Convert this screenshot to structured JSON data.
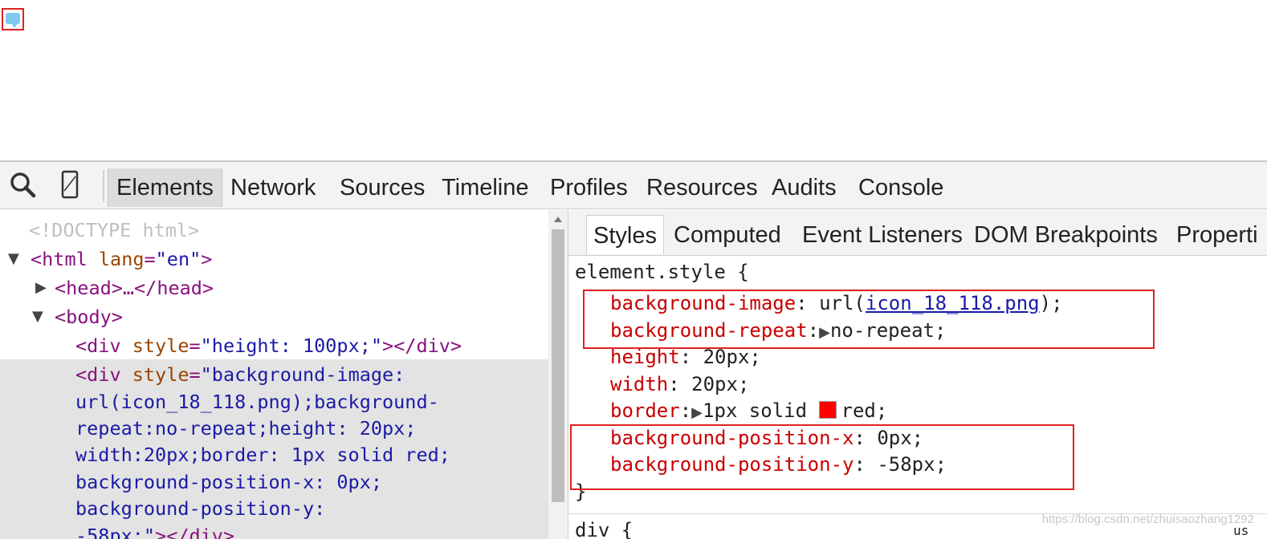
{
  "devtools": {
    "tabs": [
      "Elements",
      "Network",
      "Sources",
      "Timeline",
      "Profiles",
      "Resources",
      "Audits",
      "Console"
    ],
    "active_tab": "Elements",
    "icons": [
      "search-icon",
      "device-mode-icon"
    ]
  },
  "dom_tree": {
    "doctype": "<!DOCTYPE html>",
    "html_open": "<html",
    "html_attr": "lang",
    "html_attr_val": "\"en\"",
    "head_collapsed": "<head>…</head>",
    "body_open": "<body>",
    "div1_open": "<div",
    "div1_attr": "style",
    "div1_val": "\"height: 100px;\"",
    "div1_close": "></div>",
    "div2_open": "<div",
    "div2_attr": "style",
    "div2_val_1": "\"background-image:",
    "div2_val_2": "url(icon_18_118.png);background-",
    "div2_val_3": "repeat:no-repeat;height: 20px;",
    "div2_val_4": "width:20px;border: 1px solid red;",
    "div2_val_5": "background-position-x: 0px;",
    "div2_val_6": "background-position-y:",
    "div2_val_7": "-58px;\"",
    "div2_close": "></div>"
  },
  "styles_tabs": [
    "Styles",
    "Computed",
    "Event Listeners",
    "DOM Breakpoints",
    "Properti"
  ],
  "styles": {
    "selector": "element.style {",
    "bg_image_prop": "background-image",
    "bg_image_pre": ": url(",
    "bg_image_link": "icon_18_118.png",
    "bg_image_post": ");",
    "bg_repeat_prop": "background-repeat",
    "bg_repeat_val": "no-repeat;",
    "height_prop": "height",
    "height_val": ": 20px;",
    "width_prop": "width",
    "width_val": ": 20px;",
    "border_prop": "border",
    "border_val_1": "1px solid",
    "border_val_2": "red;",
    "bgpx_prop": "background-position-x",
    "bgpx_val": ": 0px;",
    "bgpy_prop": "background-position-y",
    "bgpy_val": ": -58px;",
    "close": "}",
    "next_selector": "div {",
    "next_right": "us"
  },
  "colors": {
    "highlight": "#e02020",
    "swatch": "#ff0000",
    "property": "#c80000"
  },
  "watermark": "https://blog.csdn.net/zhuisaozhang1292"
}
